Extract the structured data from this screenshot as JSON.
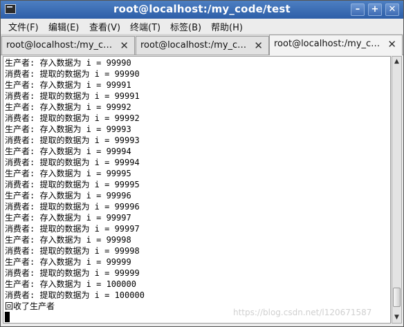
{
  "window": {
    "title": "root@localhost:/my_code/test",
    "minimize_icon": "minimize-icon",
    "maximize_icon": "maximize-icon",
    "close_icon": "close-icon"
  },
  "menu": [
    "文件(F)",
    "编辑(E)",
    "查看(V)",
    "终端(T)",
    "标签(B)",
    "帮助(H)"
  ],
  "tabs": [
    {
      "label": "root@localhost:/my_c…",
      "active": false
    },
    {
      "label": "root@localhost:/my_c…",
      "active": false
    },
    {
      "label": "root@localhost:/my_c…",
      "active": true
    }
  ],
  "terminal": {
    "lines": [
      "生产者: 存入数据为 i = 99990",
      "消费者: 提取的数据为 i = 99990",
      "生产者: 存入数据为 i = 99991",
      "消费者: 提取的数据为 i = 99991",
      "生产者: 存入数据为 i = 99992",
      "消费者: 提取的数据为 i = 99992",
      "生产者: 存入数据为 i = 99993",
      "消费者: 提取的数据为 i = 99993",
      "生产者: 存入数据为 i = 99994",
      "消费者: 提取的数据为 i = 99994",
      "生产者: 存入数据为 i = 99995",
      "消费者: 提取的数据为 i = 99995",
      "生产者: 存入数据为 i = 99996",
      "消费者: 提取的数据为 i = 99996",
      "生产者: 存入数据为 i = 99997",
      "消费者: 提取的数据为 i = 99997",
      "生产者: 存入数据为 i = 99998",
      "消费者: 提取的数据为 i = 99998",
      "生产者: 存入数据为 i = 99999",
      "消费者: 提取的数据为 i = 99999",
      "生产者: 存入数据为 i = 100000",
      "消费者: 提取的数据为 i = 100000",
      "回收了生产者"
    ]
  },
  "watermark": "https://blog.csdn.net/l120671587",
  "colors": {
    "titlebar": "#2d5ea8",
    "terminal_bg": "#ffffff",
    "terminal_fg": "#000000"
  }
}
